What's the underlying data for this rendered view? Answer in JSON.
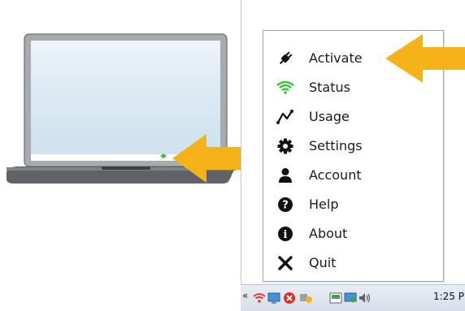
{
  "menu": {
    "items": [
      {
        "label": "Activate",
        "icon": "plug-icon"
      },
      {
        "label": "Status",
        "icon": "wifi-icon"
      },
      {
        "label": "Usage",
        "icon": "usage-graph-icon"
      },
      {
        "label": "Settings",
        "icon": "gear-icon"
      },
      {
        "label": "Account",
        "icon": "user-icon"
      },
      {
        "label": "Help",
        "icon": "help-icon"
      },
      {
        "label": "About",
        "icon": "info-icon"
      },
      {
        "label": "Quit",
        "icon": "close-icon"
      }
    ]
  },
  "taskbar": {
    "clock": "1:25 P",
    "chevron": "«"
  },
  "colors": {
    "arrow": "#f6b319",
    "wifi_green": "#3cc33c",
    "laptop_body": "#5f6368",
    "screen_blue": "#d7e7f1"
  }
}
